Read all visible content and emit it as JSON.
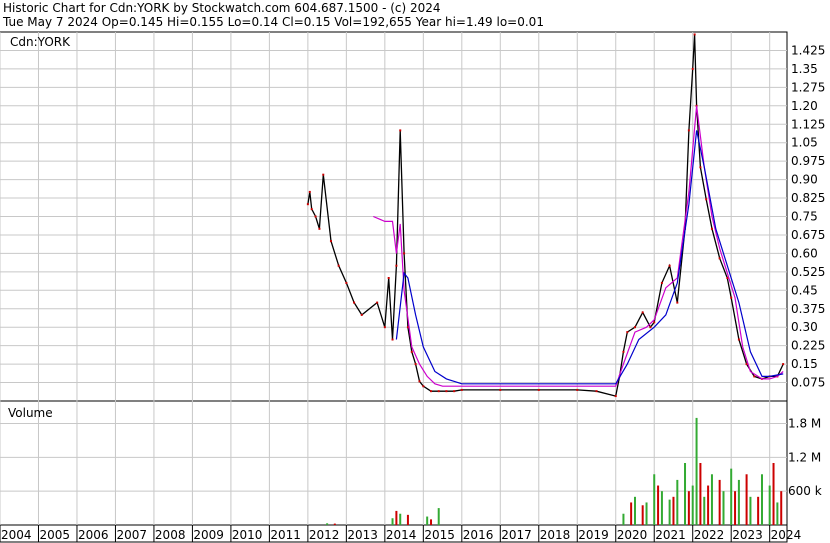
{
  "header": {
    "line1": "Historic Chart for Cdn:YORK by Stockwatch.com 604.687.1500 - (c) 2024",
    "line2": "Tue May  7 2024   Op=0.145   Hi=0.155   Lo=0.14   Cl=0.15   Vol=192,655   Year hi=1.49   lo=0.01"
  },
  "chart_data": [
    {
      "type": "line",
      "panel": "price",
      "label": "Cdn:YORK",
      "y_tick_labels": [
        "1.425",
        "1.35",
        "1.275",
        "1.20",
        "1.125",
        "1.05",
        "0.975",
        "0.90",
        "0.825",
        "0.75",
        "0.675",
        "0.60",
        "0.525",
        "0.45",
        "0.375",
        "0.30",
        "0.225",
        "0.15",
        "0.075"
      ],
      "ylim": [
        0,
        1.5
      ],
      "colors": {
        "price": "#000000",
        "down": "#cc0000",
        "ma_short": "#cc00cc",
        "ma_long": "#0000cc"
      },
      "series": [
        {
          "kind": "price",
          "x": [
            2012.0,
            2012.05,
            2012.1,
            2012.2,
            2012.3,
            2012.4,
            2012.6,
            2012.8,
            2013.0,
            2013.2,
            2013.4,
            2013.8,
            2014.0,
            2014.1,
            2014.2,
            2014.3,
            2014.4,
            2014.5,
            2014.6,
            2014.7,
            2014.8,
            2014.9,
            2015.0,
            2015.2,
            2015.4,
            2015.6,
            2015.8,
            2016.0,
            2017.0,
            2018.0,
            2019.0,
            2019.5,
            2020.0,
            2020.1,
            2020.2,
            2020.3,
            2020.5,
            2020.7,
            2020.9,
            2021.0,
            2021.2,
            2021.4,
            2021.6,
            2021.8,
            2021.9,
            2022.0,
            2022.05,
            2022.1,
            2022.2,
            2022.35,
            2022.5,
            2022.7,
            2022.9,
            2023.0,
            2023.2,
            2023.4,
            2023.6,
            2023.8,
            2024.0,
            2024.2,
            2024.35
          ],
          "y": [
            0.8,
            0.85,
            0.78,
            0.75,
            0.7,
            0.92,
            0.65,
            0.55,
            0.48,
            0.4,
            0.35,
            0.4,
            0.3,
            0.5,
            0.25,
            0.55,
            1.1,
            0.6,
            0.3,
            0.2,
            0.15,
            0.08,
            0.06,
            0.04,
            0.04,
            0.04,
            0.04,
            0.045,
            0.045,
            0.045,
            0.045,
            0.04,
            0.02,
            0.1,
            0.2,
            0.28,
            0.3,
            0.36,
            0.3,
            0.32,
            0.48,
            0.55,
            0.4,
            0.7,
            1.1,
            1.35,
            1.49,
            1.2,
            0.95,
            0.82,
            0.7,
            0.58,
            0.5,
            0.42,
            0.25,
            0.15,
            0.1,
            0.09,
            0.1,
            0.1,
            0.15
          ]
        },
        {
          "kind": "ma_short",
          "x": [
            2013.7,
            2014.0,
            2014.2,
            2014.3,
            2014.4,
            2014.5,
            2014.7,
            2014.9,
            2015.1,
            2015.3,
            2015.5,
            2016.0,
            2017.0,
            2018.0,
            2019.0,
            2020.0,
            2020.2,
            2020.5,
            2020.8,
            2021.0,
            2021.3,
            2021.6,
            2021.9,
            2022.1,
            2022.3,
            2022.5,
            2022.7,
            2022.9,
            2023.1,
            2023.3,
            2023.5,
            2023.8,
            2024.0,
            2024.2,
            2024.35
          ],
          "y": [
            0.75,
            0.73,
            0.73,
            0.6,
            0.72,
            0.45,
            0.22,
            0.15,
            0.1,
            0.07,
            0.06,
            0.06,
            0.06,
            0.06,
            0.06,
            0.06,
            0.15,
            0.28,
            0.3,
            0.33,
            0.46,
            0.5,
            0.85,
            1.2,
            0.95,
            0.75,
            0.62,
            0.52,
            0.42,
            0.22,
            0.12,
            0.09,
            0.09,
            0.1,
            0.12
          ]
        },
        {
          "kind": "ma_long",
          "x": [
            2014.3,
            2014.5,
            2014.6,
            2014.8,
            2015.0,
            2015.3,
            2015.6,
            2016.0,
            2017.0,
            2018.0,
            2019.0,
            2020.0,
            2020.3,
            2020.6,
            2021.0,
            2021.3,
            2021.6,
            2021.9,
            2022.1,
            2022.3,
            2022.6,
            2022.9,
            2023.2,
            2023.5,
            2023.8,
            2024.0,
            2024.35
          ],
          "y": [
            0.25,
            0.52,
            0.5,
            0.35,
            0.22,
            0.12,
            0.09,
            0.07,
            0.07,
            0.07,
            0.07,
            0.07,
            0.15,
            0.25,
            0.3,
            0.35,
            0.48,
            0.8,
            1.1,
            0.95,
            0.7,
            0.55,
            0.4,
            0.2,
            0.1,
            0.1,
            0.11
          ]
        }
      ]
    },
    {
      "type": "bar",
      "panel": "volume",
      "label": "Volume",
      "y_tick_labels": [
        "1.8 M",
        "1.2 M",
        "600 k"
      ],
      "ylim": [
        0,
        2200000
      ],
      "colors": {
        "up": "#33aa33",
        "down": "#cc0000"
      },
      "series": [
        {
          "name": "up",
          "x": [
            2012.5,
            2014.2,
            2014.4,
            2015.1,
            2015.4,
            2020.2,
            2020.5,
            2020.8,
            2021.0,
            2021.2,
            2021.4,
            2021.6,
            2021.8,
            2022.0,
            2022.1,
            2022.3,
            2022.5,
            2022.8,
            2023.0,
            2023.2,
            2023.5,
            2023.8,
            2024.0,
            2024.2
          ],
          "y": [
            30000,
            120000,
            200000,
            150000,
            300000,
            200000,
            500000,
            400000,
            900000,
            600000,
            450000,
            800000,
            1100000,
            700000,
            1900000,
            500000,
            900000,
            600000,
            1000000,
            800000,
            500000,
            900000,
            700000,
            400000
          ]
        },
        {
          "name": "down",
          "x": [
            2012.7,
            2014.3,
            2014.6,
            2015.2,
            2020.4,
            2020.7,
            2021.1,
            2021.5,
            2021.9,
            2022.2,
            2022.4,
            2022.7,
            2023.1,
            2023.4,
            2023.7,
            2024.1,
            2024.3
          ],
          "y": [
            25000,
            250000,
            180000,
            100000,
            400000,
            350000,
            700000,
            500000,
            600000,
            1100000,
            700000,
            800000,
            600000,
            900000,
            500000,
            1100000,
            600000
          ]
        }
      ]
    }
  ],
  "x_axis": {
    "tick_labels": [
      "2004",
      "2005",
      "2006",
      "2007",
      "2008",
      "2009",
      "2010",
      "2011",
      "2012",
      "2013",
      "2014",
      "2015",
      "2016",
      "2017",
      "2018",
      "2019",
      "2020",
      "2021",
      "2022",
      "2023",
      "2024"
    ]
  }
}
